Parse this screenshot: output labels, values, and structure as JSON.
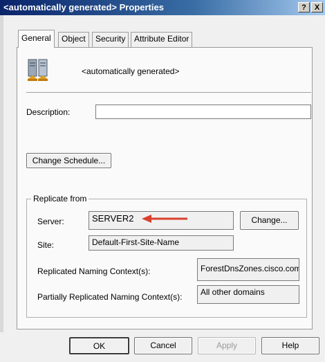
{
  "window": {
    "title": "<automatically generated> Properties",
    "help_label": "?",
    "close_label": "X"
  },
  "tabs": [
    "General",
    "Object",
    "Security",
    "Attribute Editor"
  ],
  "general": {
    "object_name": "<automatically generated>",
    "description_label": "Description:",
    "description_value": "",
    "change_schedule_label": "Change Schedule..."
  },
  "replicate_from": {
    "group_label": "Replicate from",
    "server_label": "Server:",
    "server_value": "SERVER2",
    "change_label": "Change...",
    "site_label": "Site:",
    "site_value": "Default-First-Site-Name",
    "naming_context_label": "Replicated Naming Context(s):",
    "naming_context_value": "ForestDnsZones.cisco.com",
    "partial_label": "Partially Replicated Naming Context(s):",
    "partial_value": "All other domains"
  },
  "footer": {
    "ok_label": "OK",
    "cancel_label": "Cancel",
    "apply_label": "Apply",
    "help_label": "Help"
  },
  "colors": {
    "annotation_arrow": "#d9412b",
    "titlebar": "#0a246a"
  }
}
